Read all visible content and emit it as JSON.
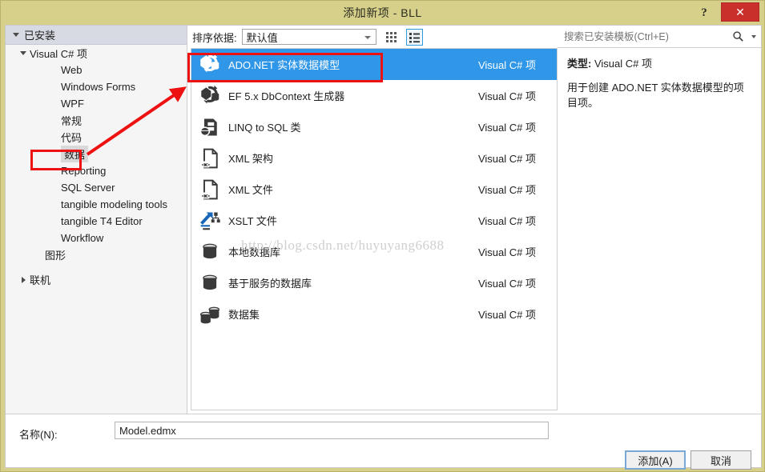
{
  "window": {
    "title": "添加新项 - BLL",
    "help_label": "?",
    "close_label": "✕"
  },
  "sidebar": {
    "header": "已安装",
    "items": [
      {
        "label": "Visual C# 项",
        "level": 1,
        "expander": "down"
      },
      {
        "label": "Web",
        "level": 2
      },
      {
        "label": "Windows Forms",
        "level": 2
      },
      {
        "label": "WPF",
        "level": 2
      },
      {
        "label": "常规",
        "level": 2
      },
      {
        "label": "代码",
        "level": 2
      },
      {
        "label": "数据",
        "level": 2,
        "selected": true
      },
      {
        "label": "Reporting",
        "level": 2
      },
      {
        "label": "SQL Server",
        "level": 2
      },
      {
        "label": "tangible modeling tools",
        "level": 2
      },
      {
        "label": "tangible T4 Editor",
        "level": 2
      },
      {
        "label": "Workflow",
        "level": 2
      },
      {
        "label": "图形",
        "level": 1.5
      },
      {
        "label": "联机",
        "level": 1,
        "expander": "right",
        "spacer": true
      }
    ]
  },
  "toolbar": {
    "sort_label": "排序依据:",
    "sort_value": "默认值",
    "view_grid_name": "grid-view-icon",
    "view_list_name": "list-view-icon"
  },
  "list": {
    "items": [
      {
        "name": "ADO.NET 实体数据模型",
        "kind": "Visual C# 项",
        "icon": "entity-model-icon",
        "selected": true
      },
      {
        "name": "EF 5.x DbContext 生成器",
        "kind": "Visual C# 项",
        "icon": "entity-model-icon"
      },
      {
        "name": "LINQ to SQL 类",
        "kind": "Visual C# 项",
        "icon": "linq-sql-icon"
      },
      {
        "name": "XML 架构",
        "kind": "Visual C# 项",
        "icon": "xml-document-icon"
      },
      {
        "name": "XML 文件",
        "kind": "Visual C# 项",
        "icon": "xml-document-icon"
      },
      {
        "name": "XSLT 文件",
        "kind": "Visual C# 项",
        "icon": "xslt-file-icon"
      },
      {
        "name": "本地数据库",
        "kind": "Visual C# 项",
        "icon": "database-icon"
      },
      {
        "name": "基于服务的数据库",
        "kind": "Visual C# 项",
        "icon": "database-icon"
      },
      {
        "name": "数据集",
        "kind": "Visual C# 项",
        "icon": "dataset-icon"
      }
    ]
  },
  "search": {
    "placeholder": "搜索已安装模板(Ctrl+E)",
    "value": "",
    "icon": "search-icon"
  },
  "details": {
    "type_label": "类型:",
    "type_value": "Visual C# 项",
    "description": "用于创建 ADO.NET 实体数据模型的项目项。"
  },
  "bottom": {
    "name_label": "名称(N):",
    "name_value": "Model.edmx",
    "add_label": "添加(A)",
    "cancel_label": "取消"
  },
  "watermark": {
    "text": "http://blog.csdn.net/huyuyang6688"
  },
  "colors": {
    "title_bar": "#d6d08a",
    "selection_blue": "#2f96e8",
    "close_red": "#c9302c",
    "annotation_red": "#ee1111",
    "sidebar_header": "#d7dae2"
  }
}
